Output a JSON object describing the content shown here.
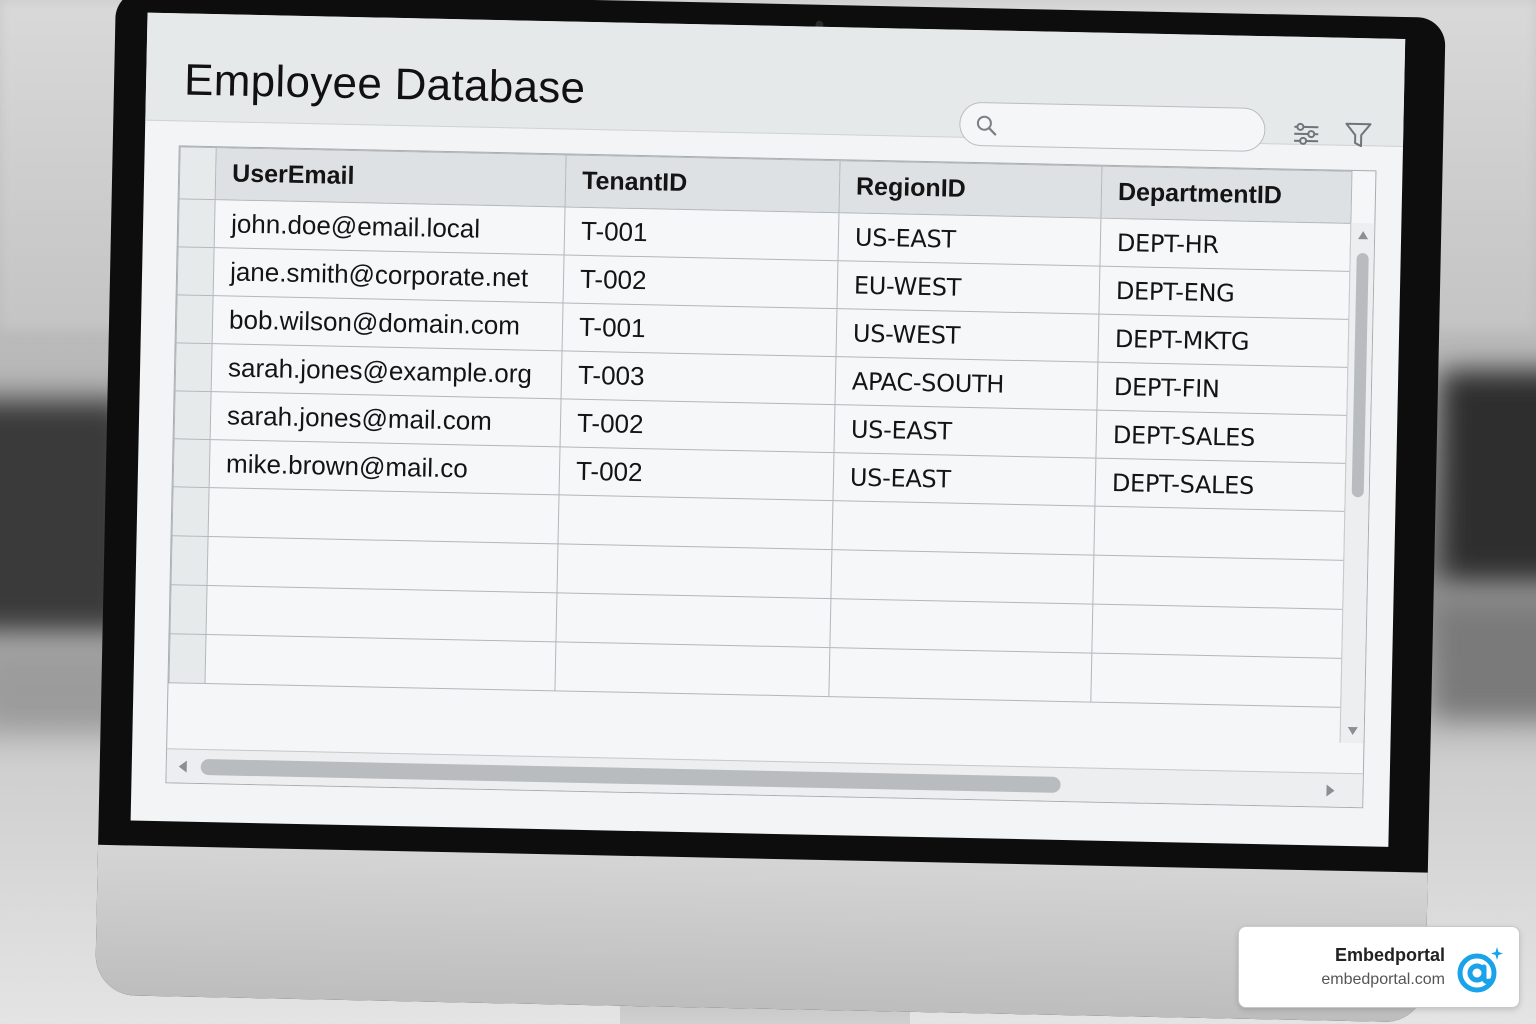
{
  "header": {
    "title": "Employee Database",
    "search_placeholder": ""
  },
  "table": {
    "columns": [
      "UserEmail",
      "TenantID",
      "RegionID",
      "DepartmentID"
    ],
    "rows": [
      [
        "john.doe@email.local",
        "T-001",
        "US-EAST",
        "DEPT-HR"
      ],
      [
        "jane.smith@corporate.net",
        "T-002",
        "EU-WEST",
        "DEPT-ENG"
      ],
      [
        "bob.wilson@domain.com",
        "T-001",
        "US-WEST",
        "DEPT-MKTG"
      ],
      [
        "sarah.jones@example.org",
        "T-003",
        "APAC-SOUTH",
        "DEPT-FIN"
      ],
      [
        "sarah.jones@mail.com",
        "T-002",
        "US-EAST",
        "DEPT-SALES"
      ],
      [
        "mike.brown@mail.co",
        "T-002",
        "US-EAST",
        "DEPT-SALES"
      ]
    ]
  },
  "watermark": {
    "name": "Embedportal",
    "url": "embedportal.com"
  },
  "colors": {
    "badge_accent": "#1aa3e8",
    "header_bg": "#e6e9ea"
  },
  "icons": {
    "search": "search-icon",
    "settings": "sliders-icon",
    "filter": "filter-icon",
    "logo": "at-sign-icon"
  }
}
